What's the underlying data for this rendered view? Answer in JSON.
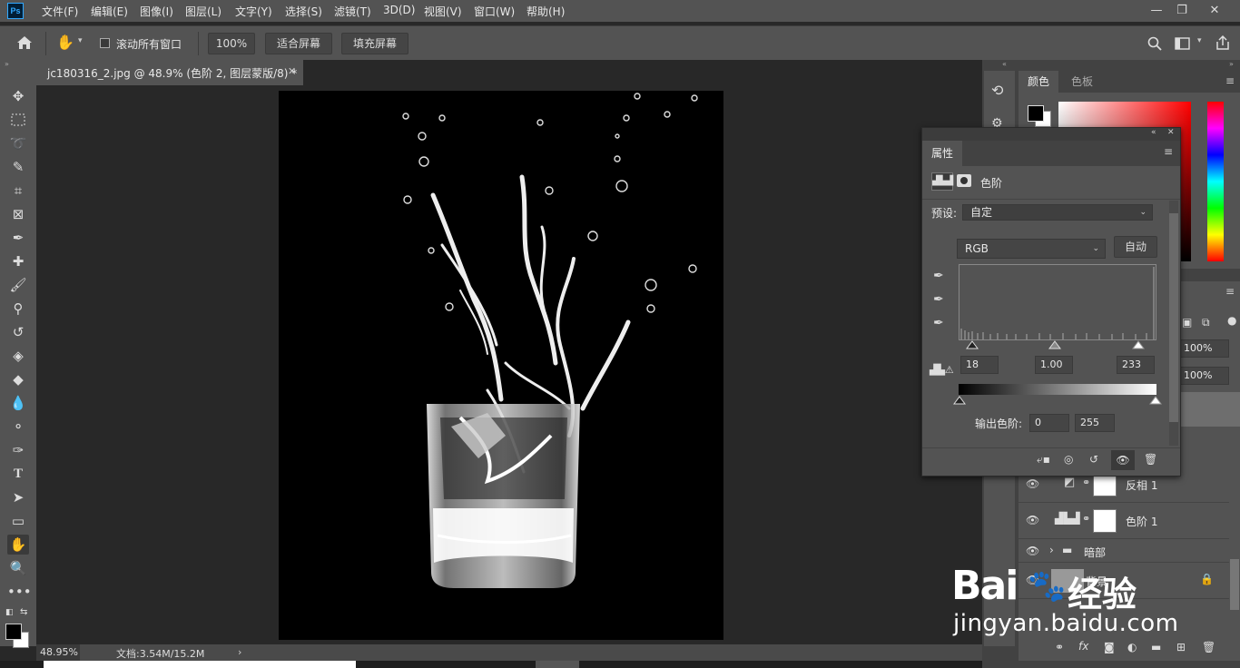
{
  "app": {
    "logo": "Ps"
  },
  "menu": [
    "文件(F)",
    "编辑(E)",
    "图像(I)",
    "图层(L)",
    "文字(Y)",
    "选择(S)",
    "滤镜(T)",
    "3D(D)",
    "视图(V)",
    "窗口(W)",
    "帮助(H)"
  ],
  "options": {
    "scroll_all_label": "滚动所有窗口",
    "zoom_value": "100%",
    "fit_screen": "适合屏幕",
    "fill_screen": "填充屏幕"
  },
  "document": {
    "tab_title": "jc180316_2.jpg @ 48.9% (色阶 2, 图层蒙版/8) *"
  },
  "status": {
    "zoom": "48.95%",
    "doc_info": "文档:3.54M/15.2M"
  },
  "color_panel": {
    "tab_color": "颜色",
    "tab_swatches": "色板"
  },
  "properties": {
    "title": "属性",
    "adjustment_name": "色阶",
    "preset_label": "预设:",
    "preset_value": "自定",
    "channel": "RGB",
    "auto_label": "自动",
    "input_black": "18",
    "input_gamma": "1.00",
    "input_white": "233",
    "output_label": "输出色阶:",
    "output_black": "0",
    "output_white": "255"
  },
  "layers_panel": {
    "opacity": "100%",
    "fill": "100%",
    "layers": [
      {
        "name": "反相 1"
      },
      {
        "name": "色阶 1"
      },
      {
        "name": "暗部"
      },
      {
        "name": "背景"
      }
    ]
  },
  "watermark": {
    "brand": "Bai",
    "brand_tail": "经验",
    "url": "jingyan.baidu.com"
  }
}
